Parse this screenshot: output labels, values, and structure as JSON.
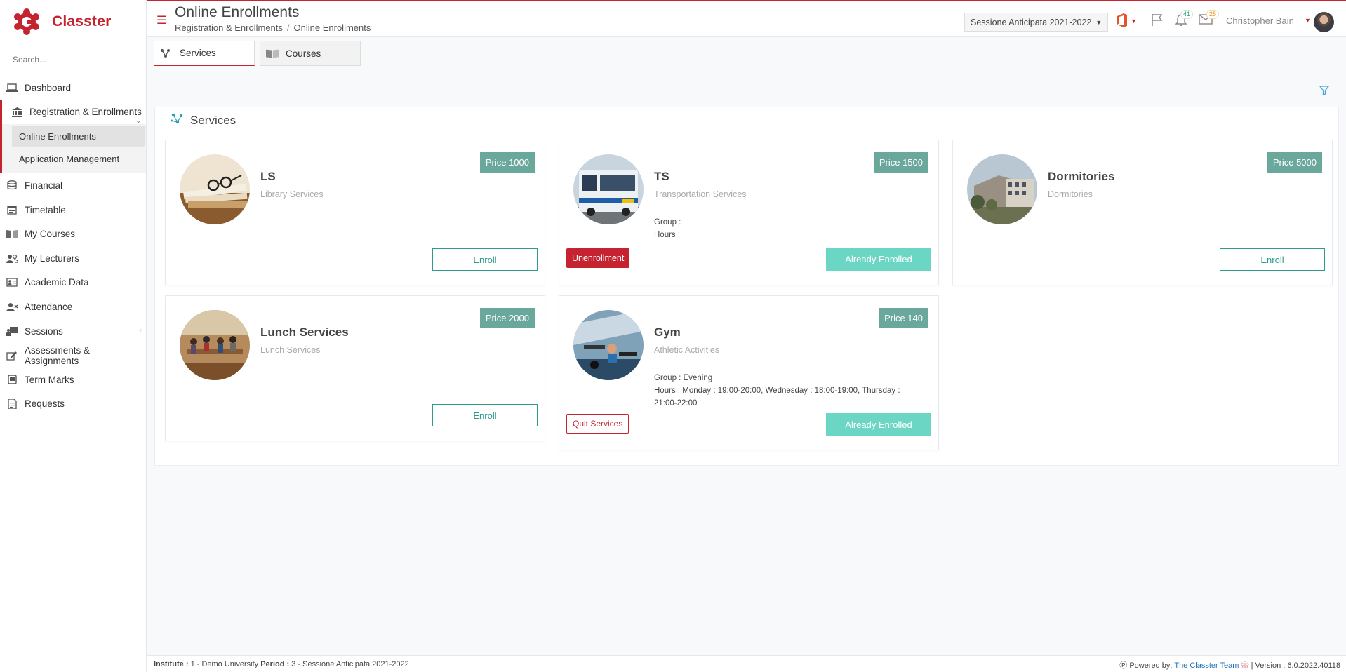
{
  "app": {
    "name": "Classter"
  },
  "search": {
    "placeholder": "Search..."
  },
  "sidebar": {
    "items": [
      {
        "label": "Dashboard",
        "icon": "laptop-icon"
      },
      {
        "label": "Registration & Enrollments",
        "icon": "bank-icon"
      },
      {
        "label": "Financial",
        "icon": "coins-icon"
      },
      {
        "label": "Timetable",
        "icon": "calendar-icon"
      },
      {
        "label": "My Courses",
        "icon": "book-icon"
      },
      {
        "label": "My Lecturers",
        "icon": "users-icon"
      },
      {
        "label": "Academic Data",
        "icon": "id-card-icon"
      },
      {
        "label": "Attendance",
        "icon": "user-x-icon"
      },
      {
        "label": "Sessions",
        "icon": "presentation-icon"
      },
      {
        "label": "Assessments & Assignments",
        "icon": "edit-icon"
      },
      {
        "label": "Term Marks",
        "icon": "tablet-icon"
      },
      {
        "label": "Requests",
        "icon": "file-icon"
      }
    ],
    "sub_items": [
      {
        "label": "Online Enrollments"
      },
      {
        "label": "Application Management"
      }
    ]
  },
  "header": {
    "title": "Online Enrollments",
    "breadcrumb": [
      "Registration & Enrollments",
      "Online Enrollments"
    ],
    "session": "Sessione Anticipata 2021-2022",
    "notifications_count": "41",
    "messages_count": "25",
    "user_name": "Christopher Bain"
  },
  "tabs": [
    {
      "label": "Services",
      "icon": "services-icon",
      "active": true
    },
    {
      "label": "Courses",
      "icon": "book-icon",
      "active": false
    }
  ],
  "section": {
    "title": "Services"
  },
  "cards": [
    {
      "name": "LS",
      "desc": "Library Services",
      "price": "Price 1000",
      "enroll": "Enroll"
    },
    {
      "name": "TS",
      "desc": "Transportation Services",
      "price": "Price 1500",
      "group": "Group :",
      "hours": "Hours :",
      "unenroll": "Unenrollment",
      "enrolled": "Already Enrolled"
    },
    {
      "name": "Dormitories",
      "desc": "Dormitories",
      "price": "Price 5000",
      "enroll": "Enroll"
    },
    {
      "name": "Lunch Services",
      "desc": "Lunch Services",
      "price": "Price 2000",
      "enroll": "Enroll"
    },
    {
      "name": "Gym",
      "desc": "Athletic Activities",
      "price": "Price 140",
      "group": "Group : Evening",
      "hours": "Hours : Monday : 19:00-20:00, Wednesday : 18:00-19:00, Thursday : 21:00-22:00",
      "quit": "Quit Services",
      "enrolled": "Already Enrolled"
    }
  ],
  "footer": {
    "institute_label": "Institute :",
    "institute_value": "1 - Demo University",
    "period_label": "Period :",
    "period_value": "3 - Sessione Anticipata 2021-2022",
    "powered_by": "Powered by:",
    "team": "The Classter Team",
    "version": "| Version : 6.0.2022.40118"
  },
  "colors": {
    "brand": "#c5232f",
    "accent": "#2d9c8b",
    "price_bg": "#6aa89c",
    "enrolled_bg": "#6bd6c4"
  }
}
